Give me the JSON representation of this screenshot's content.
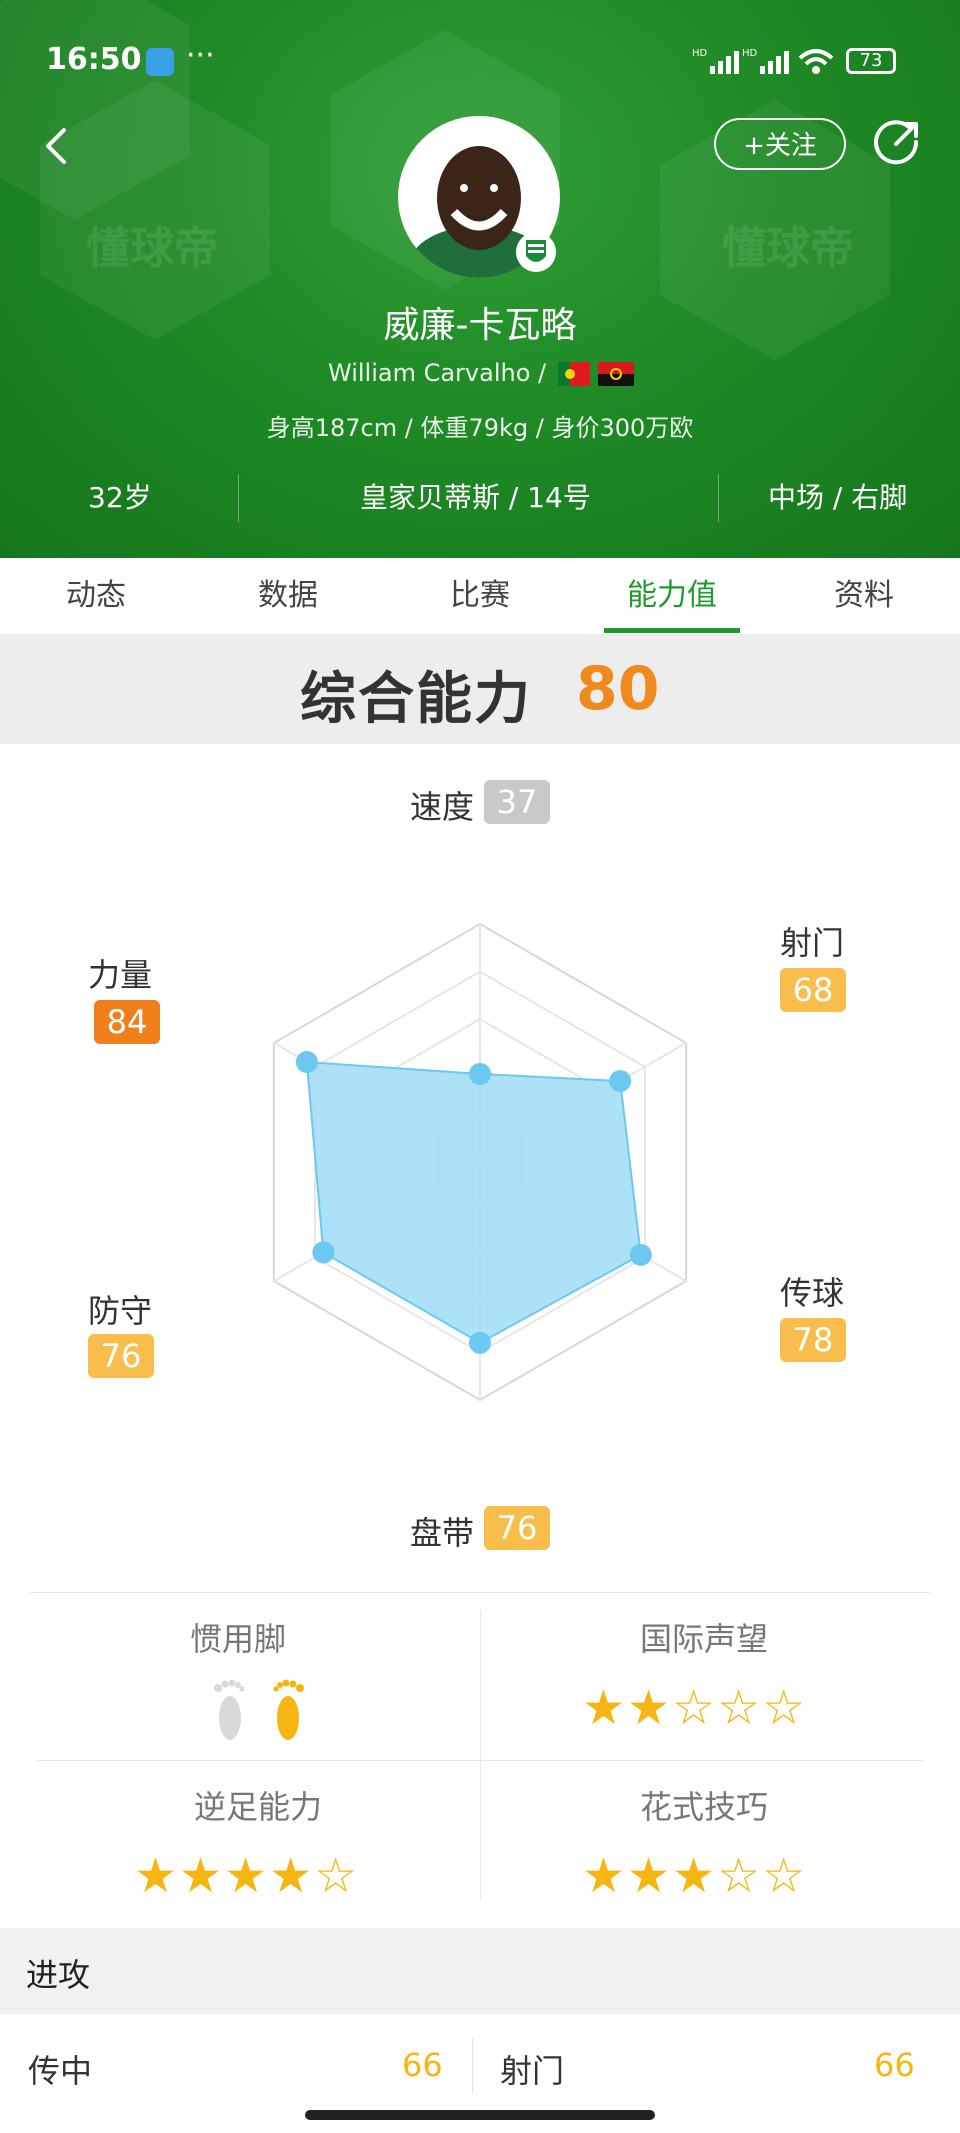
{
  "status_bar": {
    "time": "16:50",
    "more": "···",
    "battery": "73"
  },
  "header": {
    "follow_label": "+关注",
    "watermark": "懂球帝",
    "player_name": "威廉-卡瓦略",
    "player_name_en": "William Carvalho /",
    "body_line": "身高187cm / 体重79kg / 身价300万欧",
    "age": "32岁",
    "club_number": "皇家贝蒂斯 / 14号",
    "position_foot": "中场 / 右脚"
  },
  "tabs": [
    {
      "label": "动态"
    },
    {
      "label": "数据"
    },
    {
      "label": "比赛"
    },
    {
      "label": "能力值",
      "active": true
    },
    {
      "label": "资料"
    }
  ],
  "overall": {
    "label": "综合能力",
    "value": "80"
  },
  "chart_data": {
    "type": "radar",
    "axes": [
      "速度",
      "射门",
      "传球",
      "盘带",
      "防守",
      "力量"
    ],
    "values": [
      37,
      68,
      78,
      76,
      76,
      84
    ],
    "range": [
      0,
      100
    ],
    "fill_color": "#9fdcf7",
    "point_color": "#6cc8f0"
  },
  "badge_colors": {
    "low": "#c9c9c9",
    "mid": "#f9bd4c",
    "high": "#f0801c"
  },
  "traits": {
    "preferred_foot": {
      "label": "惯用脚",
      "value": "右脚"
    },
    "international_reputation": {
      "label": "国际声望",
      "stars": 2
    },
    "weak_foot": {
      "label": "逆足能力",
      "stars": 4
    },
    "skill_moves": {
      "label": "花式技巧",
      "stars": 3
    }
  },
  "attack_section": {
    "title": "进攻",
    "rows": [
      {
        "left_label": "传中",
        "left_value": "66",
        "right_label": "射门",
        "right_value": "66"
      }
    ]
  }
}
